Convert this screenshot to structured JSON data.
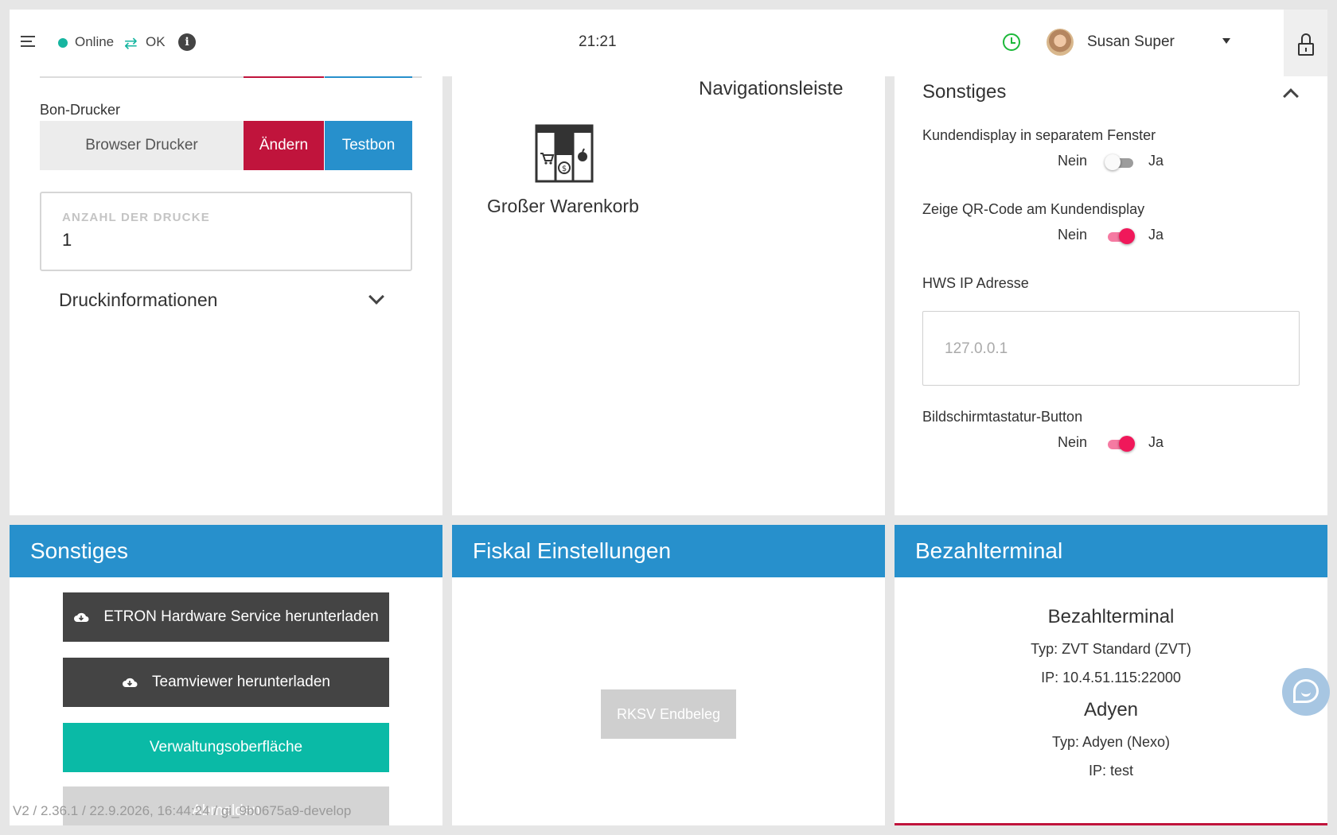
{
  "topbar": {
    "online_label": "Online",
    "sync_label": "OK",
    "time": "21:21",
    "user_name": "Susan Super"
  },
  "printer": {
    "label": "Bon-Drucker",
    "value": "Browser Drucker",
    "change_label": "Ändern",
    "test_label": "Testbon",
    "count_label": "ANZAHL DER DRUCKE",
    "count_value": "1",
    "info_header": "Druckinformationen"
  },
  "navigation": {
    "title": "Navigationsleiste",
    "option_label": "Großer Warenkorb"
  },
  "settings": {
    "title": "Sonstiges",
    "no_label": "Nein",
    "yes_label": "Ja",
    "items": [
      {
        "label": "Kundendisplay in separatem Fenster",
        "on": false
      },
      {
        "label": "Zeige QR-Code am Kundendisplay",
        "on": true
      },
      {
        "label": "Bildschirmtastatur-Button",
        "on": true
      }
    ],
    "ip_label": "HWS IP Adresse",
    "ip_placeholder": "127.0.0.1"
  },
  "misc_panel": {
    "title": "Sonstiges",
    "etron_button": "ETRON Hardware Service herunterladen",
    "teamviewer_button": "Teamviewer herunterladen",
    "admin_button": "Verwaltungsoberfläche",
    "logout_button": "Abmelden",
    "version": "V2 / 2.36.1 / 22.9.2026, 16:44:24 / gi_9b0675a9-develop"
  },
  "fiscal_panel": {
    "title": "Fiskal Einstellungen",
    "rksv_button": "RKSV Endbeleg"
  },
  "terminal_panel": {
    "title": "Bezahlterminal",
    "terminals": [
      {
        "name": "Bezahlterminal",
        "type": "Typ: ZVT Standard (ZVT)",
        "ip": "IP: 10.4.51.115:22000"
      },
      {
        "name": "Adyen",
        "type": "Typ: Adyen (Nexo)",
        "ip": "IP: test"
      }
    ]
  },
  "colors": {
    "accent_blue": "#2790cc",
    "accent_red": "#c0143c",
    "accent_teal": "#0abaa6",
    "toggle_on": "#f0185a",
    "status_online": "#16b5a0"
  },
  "icons": [
    "menu-icon",
    "status-dot",
    "sync-icon",
    "info-icon",
    "clock-icon",
    "avatar",
    "chevron-down-icon",
    "lock-icon",
    "large-cart-icon",
    "chevron-up-icon",
    "cloud-download-icon",
    "chat-icon"
  ]
}
